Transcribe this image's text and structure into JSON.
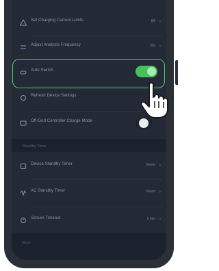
{
  "settings": {
    "row1": {
      "label": "Set Charging Current Limits",
      "value": "8A"
    },
    "row2": {
      "label": "Adjust Analysis Frequency",
      "value": "30s"
    },
    "row3": {
      "label": "Auto Switch",
      "toggle_on": true
    },
    "row4": {
      "label": "Refresh Device Settings"
    },
    "row5": {
      "label": "Off-Grid Controller Charge Mode",
      "toggle_on": false
    }
  },
  "section2": {
    "header": "Standby Timer",
    "row1": {
      "label": "Device Standby Timer",
      "value": "Never"
    },
    "row2": {
      "label": "AC Standby Timer",
      "value": "Never"
    },
    "row3": {
      "label": "Screen Timeout",
      "value": "5 min"
    }
  },
  "section3": {
    "header": "More"
  },
  "colors": {
    "screen_bg": "#1c222d",
    "group_bg": "#232a36",
    "accent_green": "#43c25c",
    "highlight_border": "#4fcf6a"
  },
  "icons": [
    "warning-icon",
    "sliders-icon",
    "switch-icon",
    "refresh-icon",
    "controller-icon",
    "standby-icon",
    "ac-icon",
    "screen-icon",
    "pointing-hand-icon"
  ]
}
